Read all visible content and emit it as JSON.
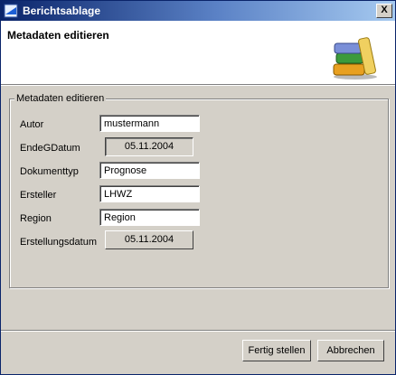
{
  "window": {
    "title": "Berichtsablage",
    "close_label": "X"
  },
  "banner": {
    "title": "Metadaten editieren"
  },
  "group": {
    "legend": "Metadaten editieren"
  },
  "form": {
    "autor": {
      "label": "Autor",
      "value": "mustermann"
    },
    "ende_g_datum": {
      "label": "EndeGDatum",
      "value": "05.11.2004"
    },
    "dokumenttyp": {
      "label": "Dokumenttyp",
      "value": "Prognose"
    },
    "ersteller": {
      "label": "Ersteller",
      "value": "LHWZ"
    },
    "region": {
      "label": "Region",
      "value": "Region"
    },
    "erstellungsdatum": {
      "label": "Erstellungsdatum",
      "value": "05.11.2004"
    }
  },
  "buttons": {
    "finish": "Fertig stellen",
    "cancel": "Abbrechen"
  }
}
